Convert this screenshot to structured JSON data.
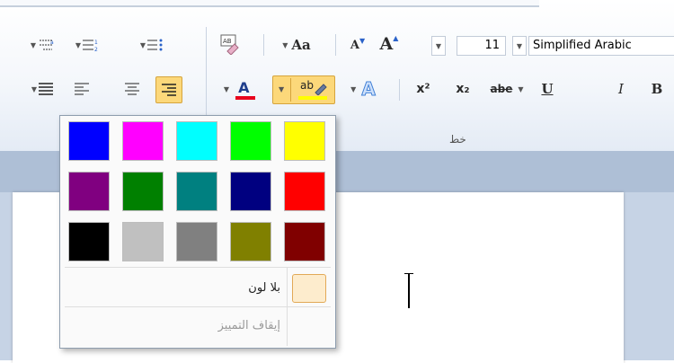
{
  "ribbon": {
    "font_size": "11",
    "font_name": "Simplified Arabic",
    "group_label": "خط",
    "buttons": {
      "grow_font": "A",
      "shrink_font": "A",
      "change_case": "Aa",
      "superscript": "x²",
      "subscript": "x₂",
      "strikethrough": "abe",
      "underline": "U",
      "italic": "I",
      "bold": "B",
      "font_color": "A",
      "highlight": "ab"
    }
  },
  "popup": {
    "colors": [
      [
        "#0000ff",
        "#ff00ff",
        "#00ffff",
        "#00ff00",
        "#ffff00"
      ],
      [
        "#800080",
        "#008000",
        "#008080",
        "#000080",
        "#ff0000"
      ],
      [
        "#000000",
        "#c0c0c0",
        "#808080",
        "#808000",
        "#800000"
      ]
    ],
    "no_color_label": "بلا لون",
    "stop_highlight_label": "إيقاف التمييز"
  }
}
